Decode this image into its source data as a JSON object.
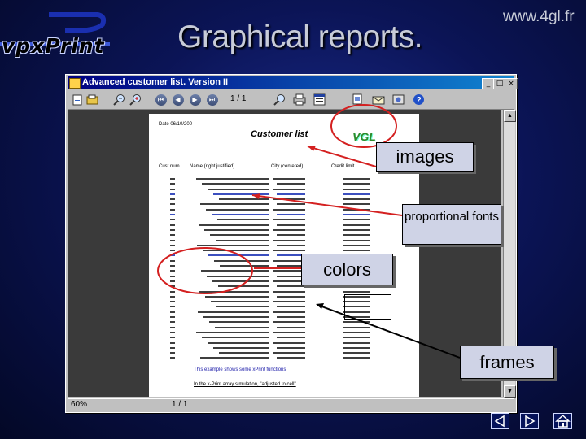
{
  "logo": {
    "text": "vpxPrint"
  },
  "slide": {
    "title": "Graphical reports.",
    "website": "www.4gl.fr"
  },
  "app": {
    "window_title": "Advanced customer list. Version II",
    "toolbar": {
      "page_indicator": "1 / 1"
    },
    "status": {
      "zoom": "60%",
      "page": "1 / 1"
    }
  },
  "report": {
    "date_label": "Date 06/10/200-",
    "title": "Customer list",
    "logo_text": "VGL",
    "columns": [
      "Cust num",
      "Name (right justified)",
      "City (centered)",
      "Credit limit"
    ],
    "note1": "This example shows some xPrint functions",
    "note2": "In the x-Print array simulation, \"adjusted to cell\""
  },
  "callouts": {
    "images": "images",
    "proportional_fonts": "proportional fonts",
    "colors": "colors",
    "frames": "frames"
  },
  "colors": {
    "callout_circle": "#d42020",
    "arrow": "#d42020",
    "link_blue": "#1a1aa8"
  },
  "icons": [
    "new-icon",
    "open-icon",
    "zoom-out-icon",
    "zoom-in-icon",
    "first-page-icon",
    "prev-page-icon",
    "next-page-icon",
    "last-page-icon",
    "search-icon",
    "print-icon",
    "export-icon",
    "select-icon",
    "mail-icon",
    "settings-icon",
    "help-icon",
    "nav-prev-icon",
    "nav-next-icon",
    "home-icon"
  ]
}
